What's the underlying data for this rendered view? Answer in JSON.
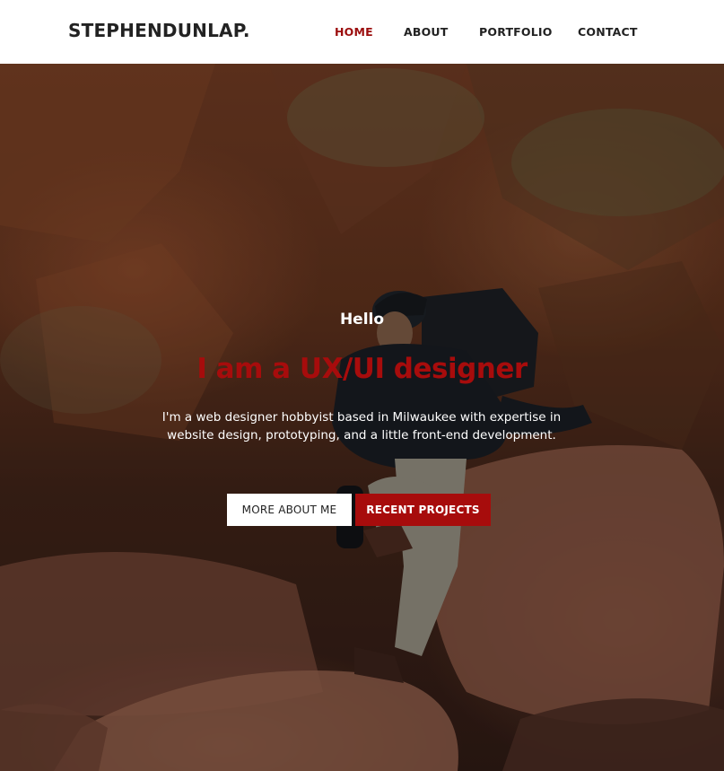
{
  "header": {
    "brand": "STEPHENDUNLAP.",
    "nav": [
      {
        "label": "HOME",
        "active": true
      },
      {
        "label": "ABOUT",
        "active": false
      },
      {
        "label": "PORTFOLIO",
        "active": false
      },
      {
        "label": "CONTACT",
        "active": false
      }
    ]
  },
  "hero": {
    "background_image": "rocky-canyon-hiker-photo",
    "greeting": "Hello",
    "headline": "I am a UX/UI designer",
    "intro": "I'm a web designer hobbyist based in Milwaukee with expertise in website design, prototyping, and a little front-end development.",
    "buttons": {
      "more_about": "MORE ABOUT ME",
      "recent_projects": "RECENT PROJECTS"
    }
  },
  "colors": {
    "accent": "#a70c0c",
    "nav_active": "#9b0d0d",
    "text_dark": "#222222",
    "header_bg": "#ffffff"
  }
}
